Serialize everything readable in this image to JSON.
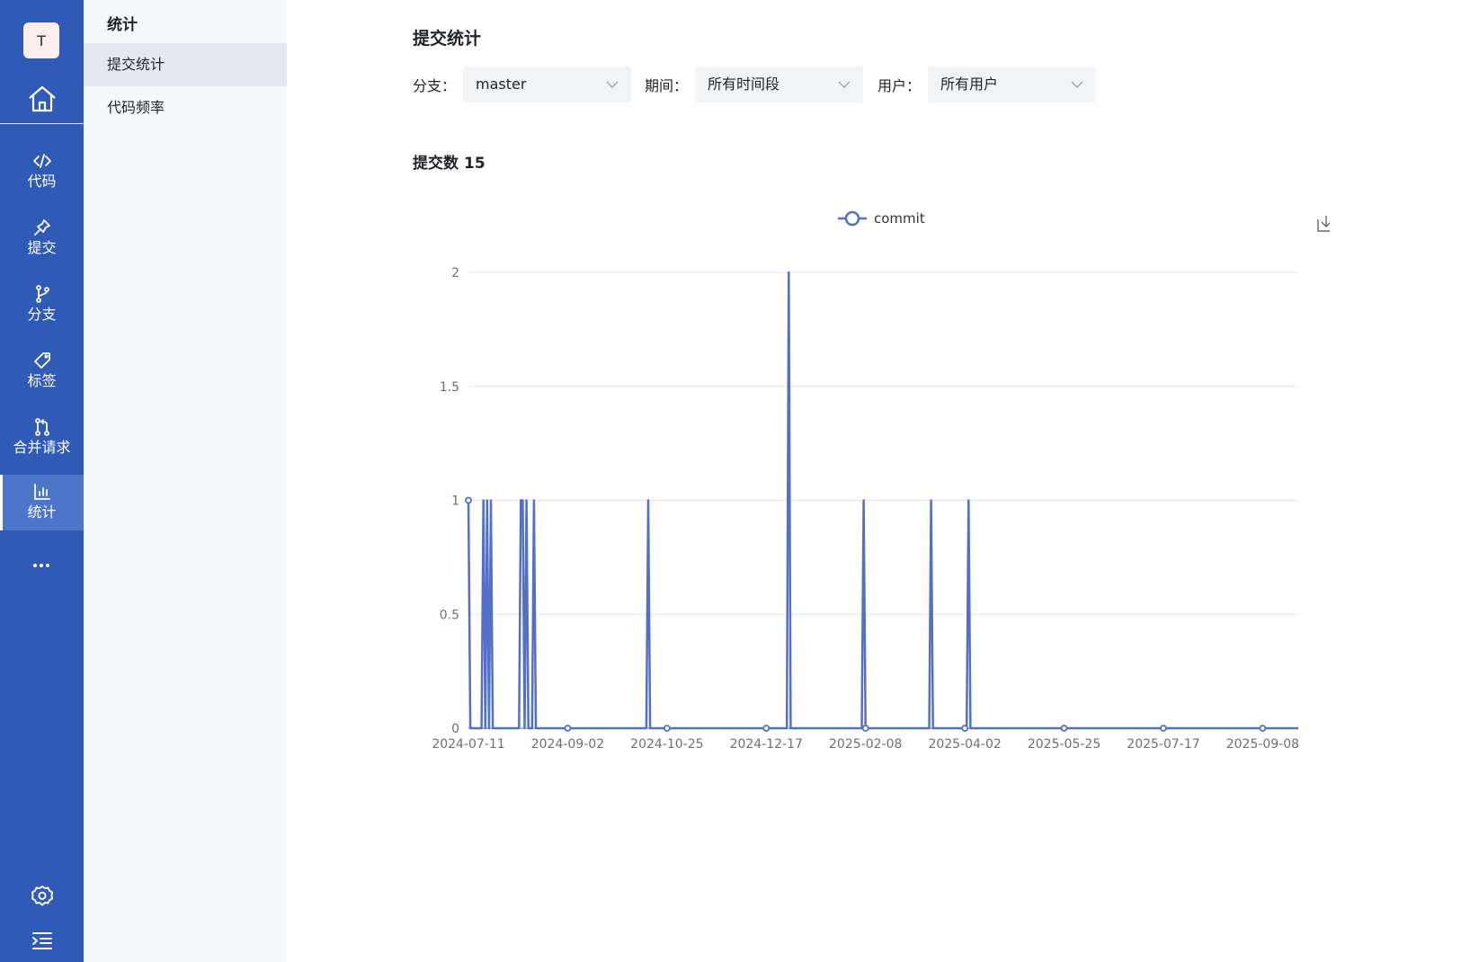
{
  "rail": {
    "avatar_letter": "T",
    "items": [
      {
        "key": "code",
        "label": "代码"
      },
      {
        "key": "commit",
        "label": "提交"
      },
      {
        "key": "branch",
        "label": "分支"
      },
      {
        "key": "tag",
        "label": "标签"
      },
      {
        "key": "merge",
        "label": "合并请求"
      },
      {
        "key": "stats",
        "label": "统计",
        "active": true
      }
    ],
    "accent": "#2f5bb7"
  },
  "subside": {
    "title": "统计",
    "items": [
      {
        "label": "提交统计",
        "active": true
      },
      {
        "label": "代码频率"
      }
    ]
  },
  "main": {
    "title": "提交统计",
    "filters": [
      {
        "label": "分支：",
        "value": "master"
      },
      {
        "label": "期间：",
        "value": "所有时间段"
      },
      {
        "label": "用户：",
        "value": "所有用户"
      }
    ],
    "count_label": "提交数",
    "count_value": "15"
  },
  "chart_data": {
    "type": "line",
    "legend": [
      "commit"
    ],
    "legend_position": "top-center",
    "series": [
      {
        "name": "commit",
        "color": "#5470c6",
        "points": [
          [
            "2024-07-11",
            1
          ],
          [
            "2024-07-12",
            0
          ],
          [
            "2024-07-18",
            0
          ],
          [
            "2024-07-19",
            1
          ],
          [
            "2024-07-20",
            0
          ],
          [
            "2024-07-21",
            1
          ],
          [
            "2024-07-22",
            0
          ],
          [
            "2024-07-23",
            1
          ],
          [
            "2024-07-24",
            0
          ],
          [
            "2024-08-07",
            0
          ],
          [
            "2024-08-08",
            1
          ],
          [
            "2024-08-09",
            1
          ],
          [
            "2024-08-10",
            0
          ],
          [
            "2024-08-11",
            1
          ],
          [
            "2024-08-12",
            0
          ],
          [
            "2024-08-14",
            0
          ],
          [
            "2024-08-15",
            1
          ],
          [
            "2024-08-16",
            0
          ],
          [
            "2024-10-14",
            0
          ],
          [
            "2024-10-15",
            1
          ],
          [
            "2024-10-16",
            0
          ],
          [
            "2024-12-28",
            0
          ],
          [
            "2024-12-29",
            2
          ],
          [
            "2024-12-30",
            0
          ],
          [
            "2025-02-06",
            0
          ],
          [
            "2025-02-07",
            1
          ],
          [
            "2025-02-08",
            0
          ],
          [
            "2025-03-14",
            0
          ],
          [
            "2025-03-15",
            1
          ],
          [
            "2025-03-16",
            0
          ],
          [
            "2025-04-03",
            0
          ],
          [
            "2025-04-04",
            1
          ],
          [
            "2025-04-05",
            0
          ],
          [
            "2025-09-27",
            0
          ]
        ],
        "markers": [
          "2024-07-11",
          "2024-09-02",
          "2024-10-25",
          "2024-12-17",
          "2025-02-08",
          "2025-04-02",
          "2025-05-25",
          "2025-07-17",
          "2025-09-08"
        ]
      }
    ],
    "x_ticks": [
      "2024-07-11",
      "2024-09-02",
      "2024-10-25",
      "2024-12-17",
      "2025-02-08",
      "2025-04-02",
      "2025-05-25",
      "2025-07-17",
      "2025-09-08"
    ],
    "x_range": [
      "2024-07-11",
      "2025-09-27"
    ],
    "y_ticks": [
      "0",
      "0.5",
      "1",
      "1.5",
      "2"
    ],
    "ylim": [
      0,
      2
    ],
    "grid": true
  }
}
